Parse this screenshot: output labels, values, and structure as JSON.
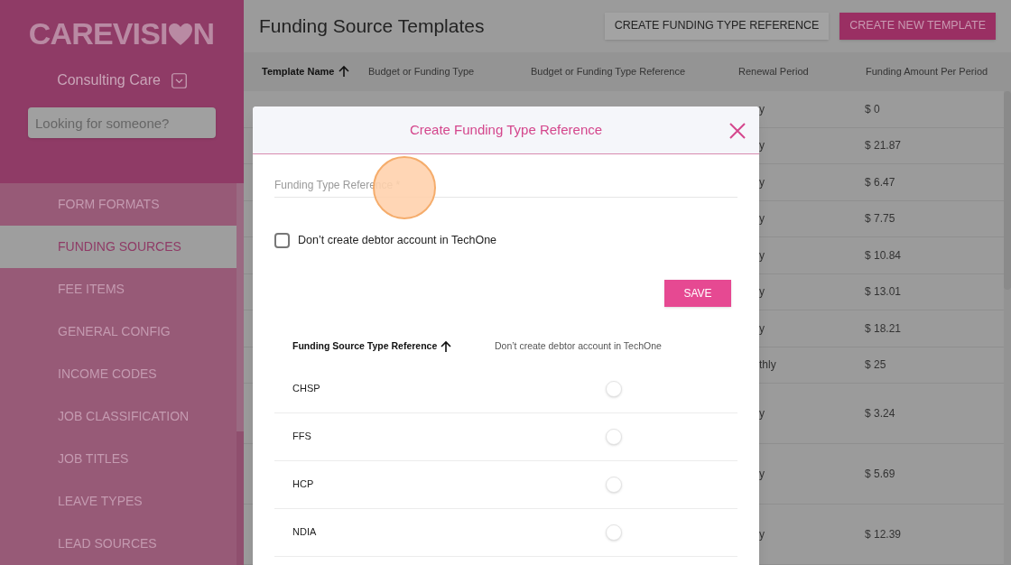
{
  "sidebar": {
    "logo": "CAREVISI",
    "logo_end": "N",
    "organization": "Consulting Care",
    "search": {
      "placeholder": "Looking for someone?"
    },
    "items": [
      {
        "label": "FORM FORMATS",
        "selected": false
      },
      {
        "label": "FUNDING SOURCES",
        "selected": true
      },
      {
        "label": "FEE ITEMS",
        "selected": false
      },
      {
        "label": "GENERAL CONFIG",
        "selected": false
      },
      {
        "label": "INCOME CODES",
        "selected": false
      },
      {
        "label": "JOB CLASSIFICATION",
        "selected": false
      },
      {
        "label": "JOB TITLES",
        "selected": false
      },
      {
        "label": "LEAVE TYPES",
        "selected": false
      },
      {
        "label": "LEAD SOURCES",
        "selected": false
      }
    ]
  },
  "page": {
    "title": "Funding Source Templates",
    "buttons": [
      {
        "label": "CREATE FUNDING TYPE REFERENCE",
        "kind": "outline"
      },
      {
        "label": "CREATE NEW TEMPLATE",
        "kind": "primary"
      }
    ]
  },
  "table": {
    "columns": [
      {
        "label": "Template Name",
        "sorted": true
      },
      {
        "label": "Budget or Funding Type",
        "sorted": false
      },
      {
        "label": "Budget or Funding Type Reference",
        "sorted": false
      },
      {
        "label": "Renewal Period",
        "sorted": false
      },
      {
        "label": "Funding Amount Per Period",
        "sorted": false
      }
    ],
    "rows": [
      {
        "renewal": "y",
        "amount": "$ 0",
        "tall": false
      },
      {
        "renewal": "y",
        "amount": "$ 21.87",
        "tall": false
      },
      {
        "renewal": "y",
        "amount": "$ 6.47",
        "tall": false
      },
      {
        "renewal": "y",
        "amount": "$ 7.75",
        "tall": false
      },
      {
        "renewal": "y",
        "amount": "$ 10.84",
        "tall": false
      },
      {
        "renewal": "y",
        "amount": "$ 13.01",
        "tall": false
      },
      {
        "renewal": "y",
        "amount": "$ 18.21",
        "tall": false
      },
      {
        "renewal": "thly",
        "amount": "$ 25",
        "tall": false
      },
      {
        "renewal": "y",
        "amount": "$ 3.24",
        "tall": true
      },
      {
        "renewal": "y",
        "amount": "$ 5.69",
        "tall": true
      },
      {
        "renewal": "y",
        "amount": "$ 12.39",
        "tall": true
      }
    ]
  },
  "dialog": {
    "title": "Create Funding Type Reference",
    "field": {
      "placeholder": "Funding Type Reference *"
    },
    "checkbox": {
      "label": "Don’t create debtor account in TechOne",
      "checked": false
    },
    "save": "SAVE",
    "columns": [
      {
        "label": "Funding Source Type Reference",
        "sorted": true
      },
      {
        "label": "Don’t create debtor account in TechOne",
        "sorted": false
      }
    ],
    "rows": [
      {
        "name": "CHSP",
        "on": false
      },
      {
        "name": "FFS",
        "on": false
      },
      {
        "name": "HCP",
        "on": false
      },
      {
        "name": "NDIA",
        "on": false
      }
    ]
  }
}
